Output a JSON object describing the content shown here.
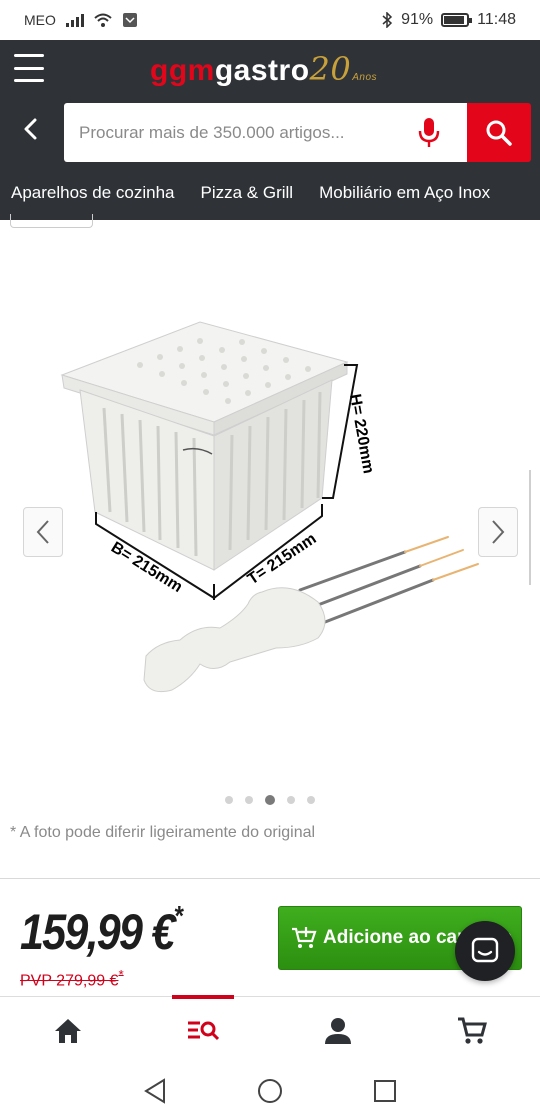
{
  "status_bar": {
    "carrier": "MEO",
    "battery": "91%",
    "time": "11:48"
  },
  "header": {
    "logo": {
      "part1": "ggm",
      "part2": "gastro",
      "part3": "20",
      "part4": "Anos"
    },
    "search": {
      "placeholder": "Procurar mais de 350.000 artigos..."
    },
    "nav_items": [
      "Aparelhos de cozinha",
      "Pizza & Grill",
      "Mobiliário em Aço Inox"
    ]
  },
  "product_image": {
    "dimension_height": "H= 220mm",
    "dimension_width": "B= 215mm",
    "dimension_depth": "T= 215mm",
    "page_count": 5,
    "active_index": 2
  },
  "note": "* A foto pode diferir ligeiramente do original",
  "purchase": {
    "price": "159,99 €",
    "price_mark": "*",
    "rrp": "PVP 279,99 €",
    "rrp_mark": "*",
    "add_button": "Adicione ao carrinho"
  },
  "colors": {
    "brand_red": "#e3061b",
    "header_bg": "#2f3338",
    "button_green": "#35a016",
    "logo_gold": "#c9a13b"
  },
  "icons": {
    "bottom_nav": [
      "home-icon",
      "category-search-icon",
      "account-icon",
      "cart-icon"
    ],
    "android": [
      "back-triangle-icon",
      "home-circle-icon",
      "recents-square-icon"
    ]
  }
}
